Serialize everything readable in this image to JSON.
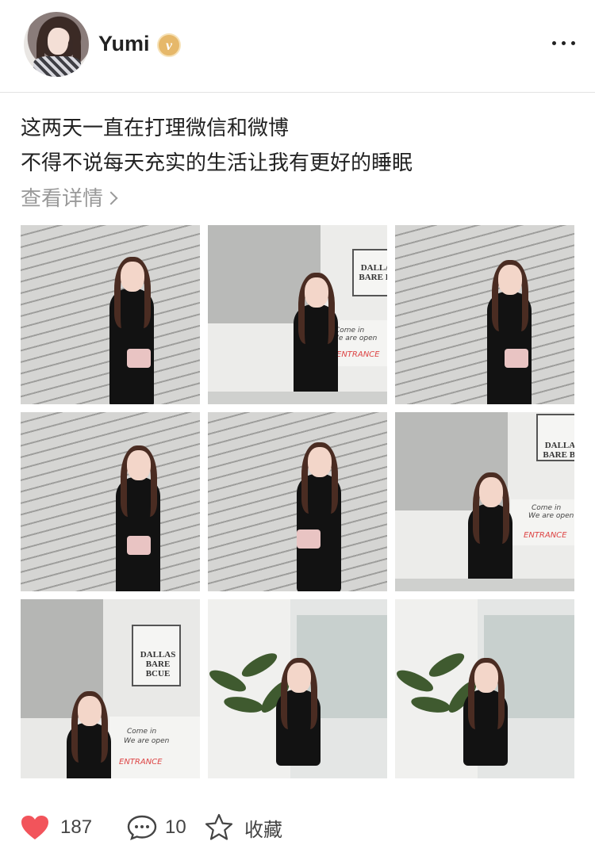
{
  "header": {
    "username": "Yumi",
    "verified_badge": "v",
    "avatar_icon": "avatar-photo",
    "more_icon": "more-dots-icon"
  },
  "post": {
    "lines": [
      "这两天一直在打理微信和微博",
      "不得不说每天充实的生活让我有更好的睡眠"
    ],
    "see_more": "查看详情"
  },
  "photos": [
    {
      "id": "photo-1"
    },
    {
      "id": "photo-2",
      "sign": "DALLAS BARE BQ",
      "banner": [
        "Come in",
        "We are open"
      ],
      "entrance": "ENTRANCE"
    },
    {
      "id": "photo-3"
    },
    {
      "id": "photo-4"
    },
    {
      "id": "photo-5"
    },
    {
      "id": "photo-6",
      "sign": "DALLAS BARE BQ",
      "banner": [
        "Come in",
        "We are open"
      ],
      "entrance": "ENTRANCE"
    },
    {
      "id": "photo-7",
      "sign": "DALLAS BARE BCUE",
      "banner": [
        "Come in",
        "We are open"
      ],
      "entrance": "ENTRANCE"
    },
    {
      "id": "photo-8"
    },
    {
      "id": "photo-9"
    }
  ],
  "actions": {
    "likes": "187",
    "comments": "10",
    "favorite_label": "收藏"
  },
  "colors": {
    "heart": "#f2545b",
    "badge": "#e6b86a",
    "muted_text": "#999999"
  }
}
